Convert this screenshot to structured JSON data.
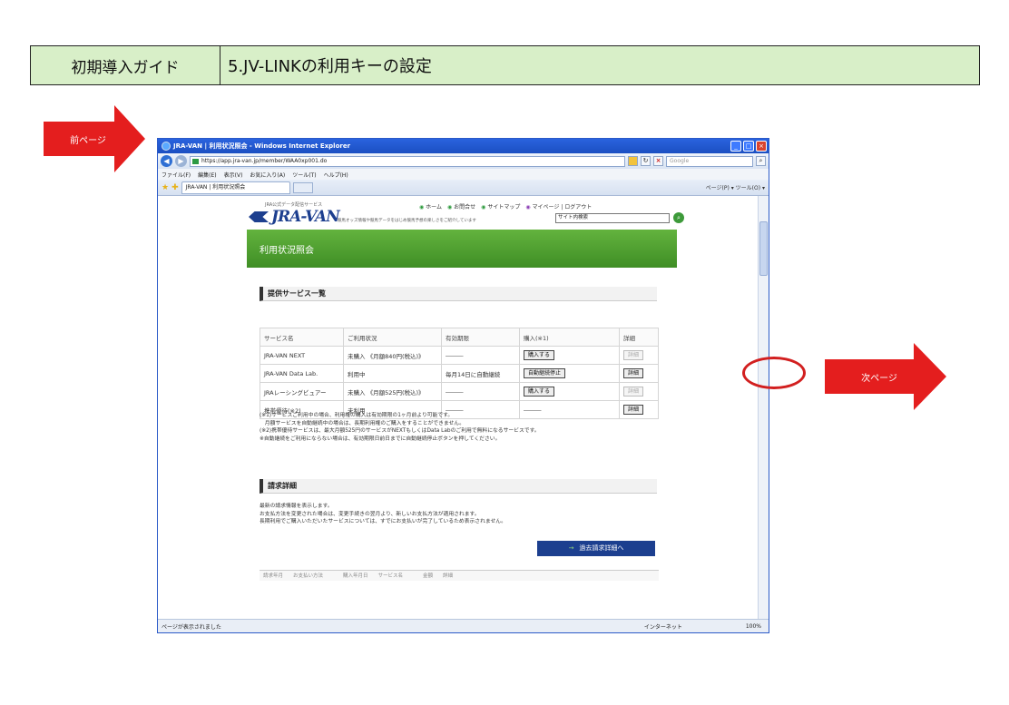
{
  "guide": {
    "section": "初期導入ガイド",
    "title": "5.JV-LINKの利用キーの設定"
  },
  "nav": {
    "prev": "前ページ",
    "next": "次ページ"
  },
  "browser": {
    "window_title": "JRA-VAN | 利用状況照会 - Windows Internet Explorer",
    "address": "https://app.jra-van.jp/member/WAA0xp001.do",
    "search_placeholder": "Google",
    "menu": [
      "ファイル(F)",
      "編集(E)",
      "表示(V)",
      "お気に入り(A)",
      "ツール(T)",
      "ヘルプ(H)"
    ],
    "tab_title": "JRA-VAN | 利用状況照会",
    "tab_tools": "ページ(P) ▾  ツール(O) ▾",
    "status_left": "ページが表示されました",
    "status_zone": "インターネット",
    "status_zoom": "100%"
  },
  "site": {
    "tagline": "JRA公式データ配信サービス",
    "logo": "JRA-VAN",
    "logo_sub": "競馬オッズ情報や競馬データをはじめ競馬予想の楽しさをご紹介しています",
    "nav": [
      "ホーム",
      "お問合せ",
      "サイトマップ",
      "マイページ | ログアウト"
    ],
    "search_placeholder": "サイト内検索",
    "page_title": "利用状況照会"
  },
  "services": {
    "heading": "提供サービス一覧",
    "columns": [
      "サービス名",
      "ご利用状況",
      "有効期限",
      "購入(※1)",
      "詳細"
    ],
    "rows": [
      {
        "name": "JRA-VAN NEXT",
        "status": "未購入 《月額840円(税込)》",
        "expiry": "―――",
        "action": "購入する",
        "detail": "詳細"
      },
      {
        "name": "JRA-VAN Data Lab.",
        "status": "利用中",
        "expiry": "毎月14日に自動継続",
        "action": "自動継続停止",
        "detail": "詳細"
      },
      {
        "name": "JRAレーシングビュアー",
        "status": "未購入 《月額525円(税込)》",
        "expiry": "―――",
        "action": "購入する",
        "detail": "詳細"
      },
      {
        "name": "携帯優待(※2)",
        "status": "未利用",
        "expiry": "―――",
        "action": "―――",
        "detail": "詳細"
      }
    ],
    "notes": [
      "(※1)サービスご利用中の場合、利用権の購入は有効期限の1ヶ月前より可能です。",
      "　月額サービスを自動継続中の場合は、長期利用権のご購入をすることができません。",
      "(※2)携帯優待サービスは、最大月額525円のサービスがNEXTもしくはData Labのご利用で無料になるサービスです。",
      "※自動継続をご利用にならない場合は、有効期限日前日までに自動継続停止ボタンを押してください。"
    ]
  },
  "billing": {
    "heading": "請求詳細",
    "notes": [
      "最新の請求情報を表示します。",
      "お支払方法を変更された場合は、変更手続きの翌月より、新しいお支払方法が適用されます。",
      "長期利用でご購入いただいたサービスについては、すでにお支払いが完了しているため表示されません。"
    ],
    "history_button": "過去請求詳細へ",
    "cut_header": "請求年月　　お支払い方法　　　　購入年月日　　サービス名　　　　金額　　詳細"
  }
}
